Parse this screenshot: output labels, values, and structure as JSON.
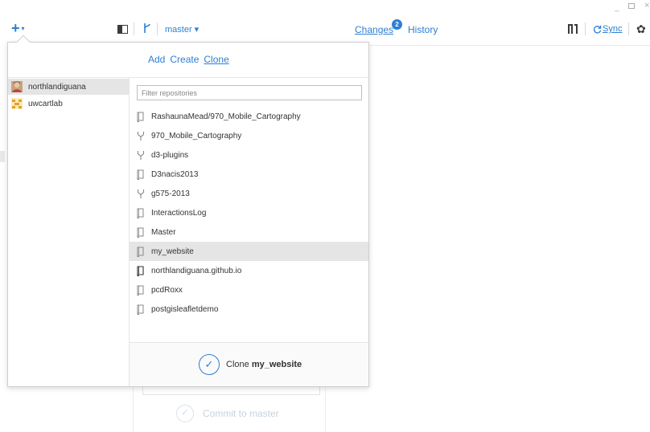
{
  "toolbar": {
    "add_button_caret": "▾",
    "branch": "master ▾",
    "tabs": {
      "changes": "Changes",
      "changes_count": "2",
      "history": "History"
    },
    "sync_label": "Sync",
    "window_controls": {
      "minimize": "_",
      "close": "×"
    }
  },
  "popover": {
    "tabs": [
      "Add",
      "Create",
      "Clone"
    ],
    "active_tab": "Clone",
    "accounts": [
      {
        "name": "northlandiguana",
        "selected": true
      },
      {
        "name": "uwcartlab",
        "selected": false
      }
    ],
    "filter_placeholder": "Filter repositories",
    "filter_value": "",
    "repositories": [
      {
        "name": "RashaunaMead/970_Mobile_Cartography",
        "icon": "repo-icon"
      },
      {
        "name": "970_Mobile_Cartography",
        "icon": "fork-icon"
      },
      {
        "name": "d3-plugins",
        "icon": "fork-icon"
      },
      {
        "name": "D3nacis2013",
        "icon": "repo-icon"
      },
      {
        "name": "g575-2013",
        "icon": "fork-icon"
      },
      {
        "name": "InteractionsLog",
        "icon": "repo-icon"
      },
      {
        "name": "Master",
        "icon": "repo-icon"
      },
      {
        "name": "my_website",
        "icon": "repo-icon",
        "selected": true
      },
      {
        "name": "northlandiguana.github.io",
        "icon": "repo-icon-dark"
      },
      {
        "name": "pcdRoxx",
        "icon": "repo-icon"
      },
      {
        "name": "postgisleafletdemo",
        "icon": "repo-icon"
      }
    ],
    "clone_button": {
      "prefix": "Clone",
      "repo": "my_website"
    }
  },
  "background": {
    "commit_label": "Commit to master"
  },
  "colors": {
    "accent": "#2d7fd2",
    "selected_row": "#e5e5e5"
  }
}
